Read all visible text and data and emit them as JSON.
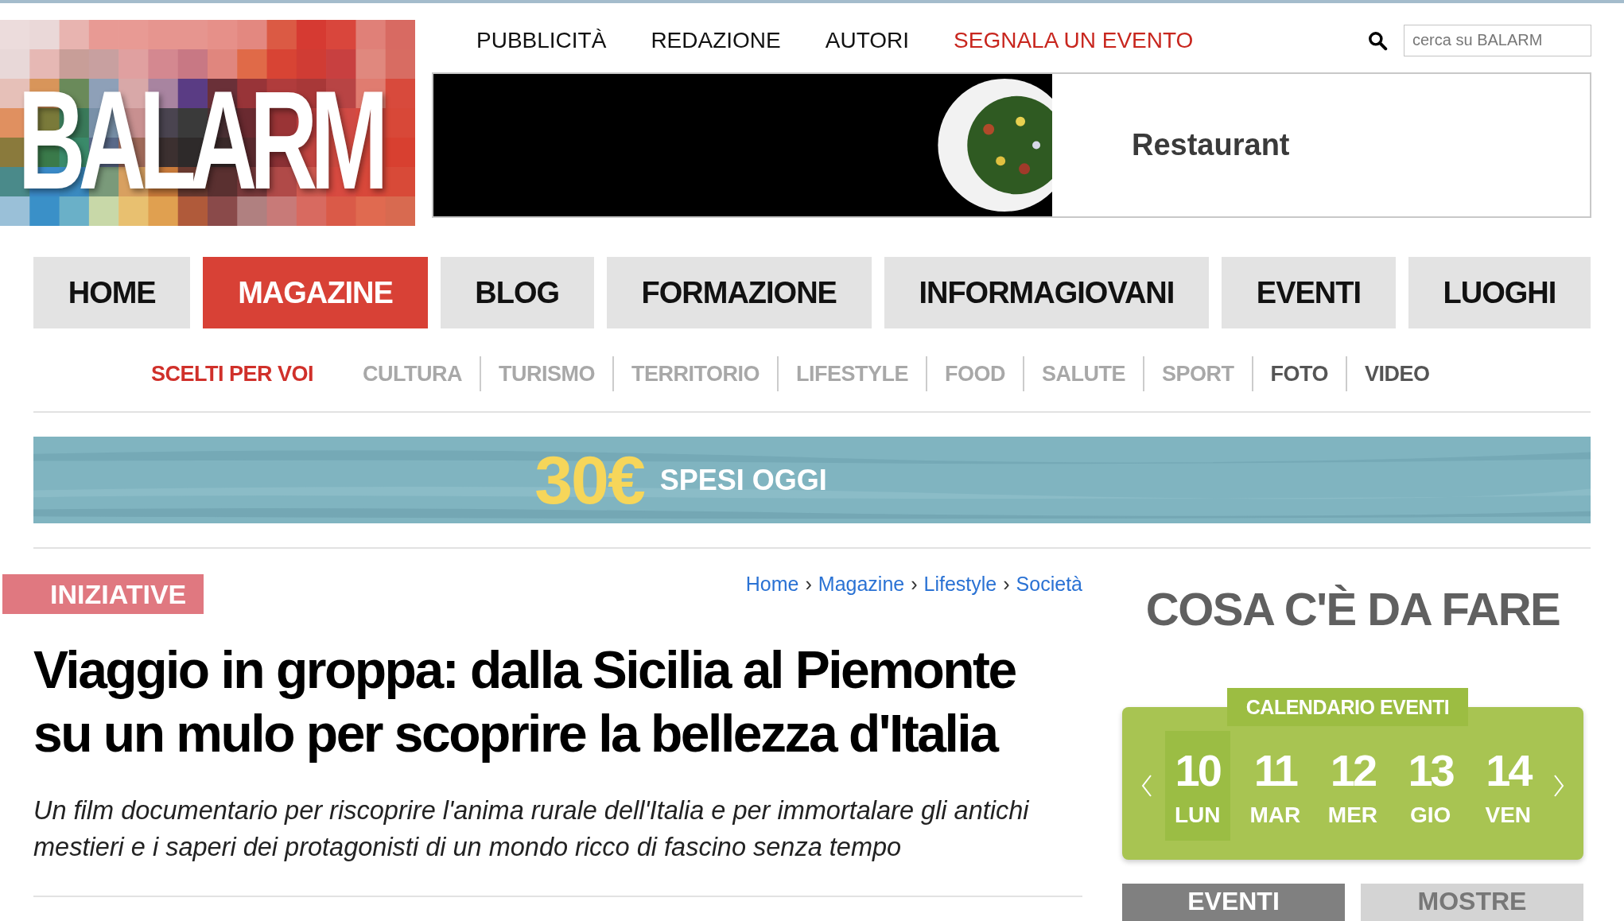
{
  "logo": {
    "text": "BALARM"
  },
  "top_links": [
    {
      "label": "PUBBLICITÀ",
      "kind": "plain"
    },
    {
      "label": "REDAZIONE",
      "kind": "plain"
    },
    {
      "label": "AUTORI",
      "kind": "plain"
    },
    {
      "label": "SEGNALA UN EVENTO",
      "kind": "cta"
    }
  ],
  "search": {
    "placeholder": "cerca su BALARM"
  },
  "ad": {
    "text": "Restaurant"
  },
  "main_nav": [
    {
      "label": "HOME",
      "selected": false
    },
    {
      "label": "MAGAZINE",
      "selected": true
    },
    {
      "label": "BLOG",
      "selected": false
    },
    {
      "label": "FORMAZIONE",
      "selected": false
    },
    {
      "label": "INFORMAGIOVANI",
      "selected": false
    },
    {
      "label": "EVENTI",
      "selected": false
    },
    {
      "label": "LUOGHI",
      "selected": false
    }
  ],
  "sub_nav": [
    {
      "label": "SCELTI PER VOI",
      "selected": true,
      "kind": "section"
    },
    {
      "label": "CULTURA",
      "selected": false,
      "kind": "section"
    },
    {
      "label": "TURISMO",
      "selected": false,
      "kind": "section"
    },
    {
      "label": "TERRITORIO",
      "selected": false,
      "kind": "section"
    },
    {
      "label": "LIFESTYLE",
      "selected": false,
      "kind": "section"
    },
    {
      "label": "FOOD",
      "selected": false,
      "kind": "section"
    },
    {
      "label": "SALUTE",
      "selected": false,
      "kind": "section"
    },
    {
      "label": "SPORT",
      "selected": false,
      "kind": "section"
    },
    {
      "label": "FOTO",
      "selected": false,
      "kind": "media"
    },
    {
      "label": "VIDEO",
      "selected": false,
      "kind": "media"
    }
  ],
  "promo": {
    "amount": "30€",
    "text": "SPESI OGGI"
  },
  "article": {
    "tag": "INIZIATIVE",
    "breadcrumb": [
      {
        "kind": "link",
        "text": "Home"
      },
      {
        "kind": "separator",
        "text": "›"
      },
      {
        "kind": "link",
        "text": "Magazine"
      },
      {
        "kind": "separator",
        "text": "›"
      },
      {
        "kind": "link",
        "text": "Lifestyle"
      },
      {
        "kind": "separator",
        "text": "›"
      },
      {
        "kind": "link",
        "text": "Società"
      }
    ],
    "title": "Viaggio in groppa: dalla Sicilia al Piemonte su un mulo per scoprire la bellezza d'Italia",
    "subtitle": "Un film documentario per riscoprire l'anima rurale dell'Italia e per immortalare gli antichi mestieri e i saperi dei protagonisti di un mondo ricco di fascino senza tempo"
  },
  "sidebar": {
    "heading": "COSA C'È DA FARE",
    "calendar": {
      "title": "CALENDARIO EVENTI",
      "days": [
        {
          "day": "10",
          "weekday": "LUN",
          "selected": true
        },
        {
          "day": "11",
          "weekday": "MAR",
          "selected": false
        },
        {
          "day": "12",
          "weekday": "MER",
          "selected": false
        },
        {
          "day": "13",
          "weekday": "GIO",
          "selected": false
        },
        {
          "day": "14",
          "weekday": "VEN",
          "selected": false
        }
      ]
    },
    "tabs": [
      {
        "label": "EVENTI",
        "selected": true
      },
      {
        "label": "MOSTRE",
        "selected": false
      }
    ]
  }
}
